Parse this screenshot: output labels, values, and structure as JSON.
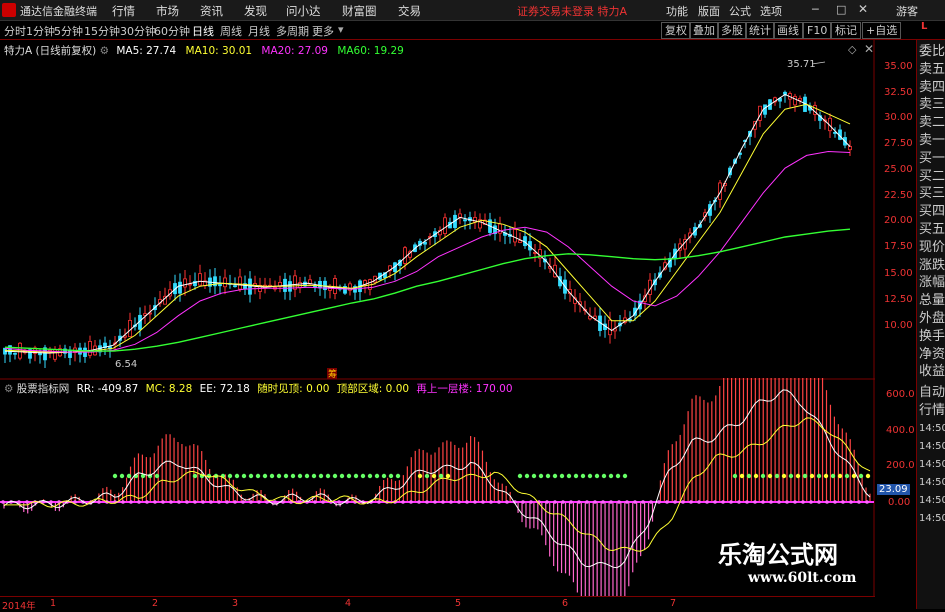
{
  "menubar": {
    "app_title": "通达信金融终端",
    "items": [
      "行情",
      "市场",
      "资讯",
      "发现",
      "问小达",
      "财富圈",
      "交易"
    ],
    "login_status": "证券交易未登录",
    "stock_name": "特力A",
    "right_items": [
      "功能",
      "版面",
      "公式",
      "选项"
    ],
    "guest": "游客"
  },
  "periodbar": {
    "periods": [
      "分时",
      "1分钟",
      "5分钟",
      "15分钟",
      "30分钟",
      "60分钟",
      "日线",
      "周线",
      "月线",
      "多周期",
      "更多"
    ],
    "active": "日线",
    "tools": [
      "复权",
      "叠加",
      "多股",
      "统计",
      "画线",
      "F10",
      "标记",
      "+自选"
    ]
  },
  "main_chart": {
    "title": "特力A (日线前复权)",
    "ma": [
      {
        "label": "MA5: 27.74",
        "color": "#ffffff"
      },
      {
        "label": "MA10: 30.01",
        "color": "#ffff33"
      },
      {
        "label": "MA20: 27.09",
        "color": "#ff33ff"
      },
      {
        "label": "MA60: 19.29",
        "color": "#33ff33"
      }
    ],
    "y_ticks": [
      "35.00",
      "32.50",
      "30.00",
      "27.50",
      "25.00",
      "22.50",
      "20.00",
      "17.50",
      "15.00",
      "12.50",
      "10.00"
    ],
    "high_label": "35.71",
    "low_label": "6.54",
    "marker": "筹"
  },
  "sub_chart": {
    "title": "股票指标网",
    "items": [
      {
        "label": "RR: -409.87",
        "color": "#ffffff"
      },
      {
        "label": "MC: 8.28",
        "color": "#ffff33"
      },
      {
        "label": "EE: 72.18",
        "color": "#ffffff"
      },
      {
        "label": "随时见顶: 0.00",
        "color": "#ffff33"
      },
      {
        "label": "顶部区域: 0.00",
        "color": "#ffff33"
      },
      {
        "label": "再上一层楼: 170.00",
        "color": "#ff33ff"
      }
    ],
    "y_ticks": [
      "600.0",
      "400.0",
      "200.0",
      "0.00"
    ],
    "value_badge": "23.09"
  },
  "x_axis": [
    "2014年",
    "1",
    "2",
    "3",
    "4",
    "5",
    "6",
    "7"
  ],
  "side_tabs": [
    "委比",
    "卖五",
    "卖四",
    "卖三",
    "卖二",
    "卖一",
    "买一",
    "买二",
    "买三",
    "买四",
    "买五",
    "现价",
    "涨跌",
    "涨幅",
    "总量",
    "外盘",
    "换手",
    "净资",
    "收益"
  ],
  "side_tabs_lower": [
    "自动",
    "行情",
    "14:50",
    "14:50",
    "14:50",
    "14:50",
    "14:50",
    "14:50"
  ],
  "watermark": {
    "main": "乐淘公式网",
    "url": "www.60lt.com"
  },
  "colors": {
    "up": "#ff3333",
    "down": "#33ddff",
    "ma5": "#ffffff",
    "ma10": "#ffff33",
    "ma20": "#ff33ff",
    "ma60": "#33ff33",
    "border": "#7a0000"
  },
  "chart_data": {
    "type": "line",
    "x": [
      0,
      1,
      2,
      3,
      4,
      5,
      6,
      7,
      8,
      9,
      10,
      11,
      12,
      13,
      14,
      15,
      16,
      17,
      18,
      19,
      20,
      21,
      22,
      23,
      24,
      25,
      26,
      27,
      28,
      29,
      30,
      31,
      32,
      33,
      34,
      35,
      36,
      37,
      38,
      39
    ],
    "series": [
      {
        "name": "MA5",
        "values": [
          6.9,
          6.8,
          6.7,
          6.8,
          7.0,
          7.5,
          9.5,
          11.5,
          13.5,
          14.0,
          13.8,
          13.6,
          13.4,
          13.6,
          13.8,
          13.4,
          13.2,
          14.0,
          15.5,
          17.5,
          19.0,
          20.5,
          20.0,
          19.0,
          18.0,
          16.0,
          13.0,
          10.5,
          9.0,
          10.5,
          14.0,
          17.0,
          19.5,
          23.0,
          27.5,
          31.5,
          33.0,
          32.0,
          30.0,
          27.7
        ]
      },
      {
        "name": "MA10",
        "values": [
          7.0,
          6.9,
          6.8,
          6.8,
          6.9,
          7.2,
          8.5,
          10.5,
          12.5,
          13.5,
          13.8,
          13.7,
          13.5,
          13.5,
          13.6,
          13.5,
          13.3,
          13.7,
          14.8,
          16.5,
          18.0,
          19.5,
          20.2,
          19.8,
          19.0,
          17.5,
          15.0,
          12.5,
          10.0,
          10.0,
          12.0,
          15.0,
          18.0,
          21.0,
          25.0,
          29.0,
          31.5,
          32.0,
          31.0,
          30.0
        ]
      },
      {
        "name": "MA20",
        "values": [
          7.2,
          7.0,
          6.9,
          6.8,
          6.8,
          7.0,
          7.6,
          8.8,
          10.5,
          12.0,
          12.8,
          13.2,
          13.3,
          13.3,
          13.4,
          13.3,
          13.2,
          13.4,
          14.0,
          15.0,
          16.5,
          17.5,
          18.5,
          19.2,
          19.5,
          19.0,
          17.5,
          15.5,
          13.5,
          12.0,
          11.5,
          12.5,
          14.5,
          17.0,
          20.0,
          23.0,
          25.5,
          26.8,
          27.2,
          27.1
        ]
      },
      {
        "name": "MA60",
        "values": [
          7.3,
          7.2,
          7.1,
          7.0,
          6.9,
          6.9,
          7.1,
          7.4,
          7.8,
          8.3,
          8.8,
          9.3,
          9.8,
          10.3,
          10.8,
          11.3,
          11.8,
          12.2,
          12.8,
          13.5,
          14.0,
          14.6,
          15.2,
          15.8,
          16.3,
          16.6,
          16.8,
          16.7,
          16.5,
          16.3,
          16.2,
          16.3,
          16.6,
          17.0,
          17.5,
          18.0,
          18.5,
          18.8,
          19.1,
          19.3
        ]
      }
    ],
    "ylim": [
      6.0,
      36.5
    ]
  }
}
